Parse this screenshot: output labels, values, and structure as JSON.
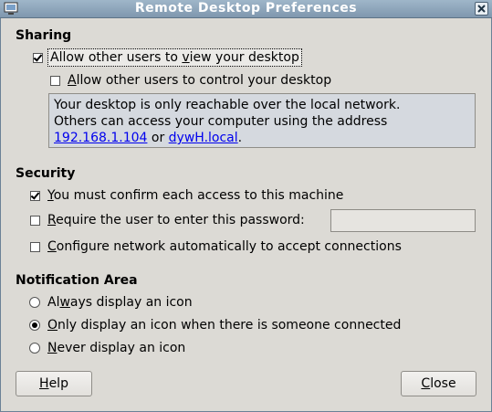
{
  "window": {
    "title": "Remote Desktop Preferences"
  },
  "sharing": {
    "heading": "Sharing",
    "allow_view": {
      "pre": "Allow other users to ",
      "mnemonic": "v",
      "post": "iew your desktop",
      "checked": true
    },
    "allow_control": {
      "pre": "",
      "mnemonic": "A",
      "post": "llow other users to control your desktop",
      "checked": false
    },
    "info": {
      "line1": "Your desktop is only reachable over the local network.",
      "line2": "Others can access your computer using the address",
      "address_ip": "192.168.1.104",
      "or_text": " or ",
      "address_host": "dywH.local",
      "end": "."
    }
  },
  "security": {
    "heading": "Security",
    "confirm": {
      "pre": "",
      "mnemonic": "Y",
      "post": "ou must confirm each access to this machine",
      "checked": true
    },
    "password": {
      "pre": "",
      "mnemonic": "R",
      "post": "equire the user to enter this password:",
      "checked": false,
      "value": ""
    },
    "network": {
      "pre": "",
      "mnemonic": "C",
      "post": "onfigure network automatically to accept connections",
      "checked": false
    }
  },
  "notification": {
    "heading": "Notification Area",
    "options": [
      {
        "pre": "Al",
        "mnemonic": "w",
        "post": "ays display an icon",
        "selected": false
      },
      {
        "pre": "",
        "mnemonic": "O",
        "post": "nly display an icon when there is someone connected",
        "selected": true
      },
      {
        "pre": "",
        "mnemonic": "N",
        "post": "ever display an icon",
        "selected": false
      }
    ]
  },
  "buttons": {
    "help": {
      "mnemonic": "H",
      "post": "elp"
    },
    "close": {
      "mnemonic": "C",
      "post": "lose"
    }
  },
  "icons": {
    "app": "monitor-icon",
    "close": "close-x-icon"
  }
}
